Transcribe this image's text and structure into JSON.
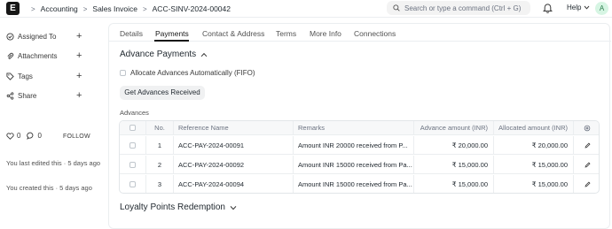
{
  "navbar": {
    "logo": "E",
    "breadcrumbs": [
      "Accounting",
      "Sales Invoice",
      "ACC-SINV-2024-00042"
    ],
    "search_placeholder": "Search or type a command (Ctrl + G)",
    "help_label": "Help",
    "avatar_initial": "A"
  },
  "sidebar": {
    "assigned_to": "Assigned To",
    "attachments": "Attachments",
    "tags": "Tags",
    "share": "Share",
    "likes_count": "0",
    "comments_count": "0",
    "follow_label": "FOLLOW",
    "last_edited": "You last edited this · 5 days ago",
    "created": "You created this · 5 days ago"
  },
  "tabs": [
    {
      "label": "Details",
      "active": false
    },
    {
      "label": "Payments",
      "active": true
    },
    {
      "label": "Contact & Address",
      "active": false
    },
    {
      "label": "Terms",
      "active": false
    },
    {
      "label": "More Info",
      "active": false
    },
    {
      "label": "Connections",
      "active": false
    }
  ],
  "advance_payments": {
    "title": "Advance Payments",
    "allocate_label": "Allocate Advances Automatically (FIFO)",
    "get_button": "Get Advances Received",
    "table_label": "Advances",
    "columns": [
      "No.",
      "Reference Name",
      "Remarks",
      "Advance amount (INR)",
      "Allocated amount (INR)"
    ],
    "rows": [
      {
        "no": "1",
        "reference": "ACC-PAY-2024-00091",
        "remarks": "Amount INR 20000 received from P...",
        "advance": "₹ 20,000.00",
        "allocated": "₹ 20,000.00"
      },
      {
        "no": "2",
        "reference": "ACC-PAY-2024-00092",
        "remarks": "Amount INR 15000 received from Pa...",
        "advance": "₹ 15,000.00",
        "allocated": "₹ 15,000.00"
      },
      {
        "no": "3",
        "reference": "ACC-PAY-2024-00094",
        "remarks": "Amount INR 15000 received from Pa...",
        "advance": "₹ 15,000.00",
        "allocated": "₹ 15,000.00"
      }
    ]
  },
  "loyalty": {
    "title": "Loyalty Points Redemption"
  }
}
